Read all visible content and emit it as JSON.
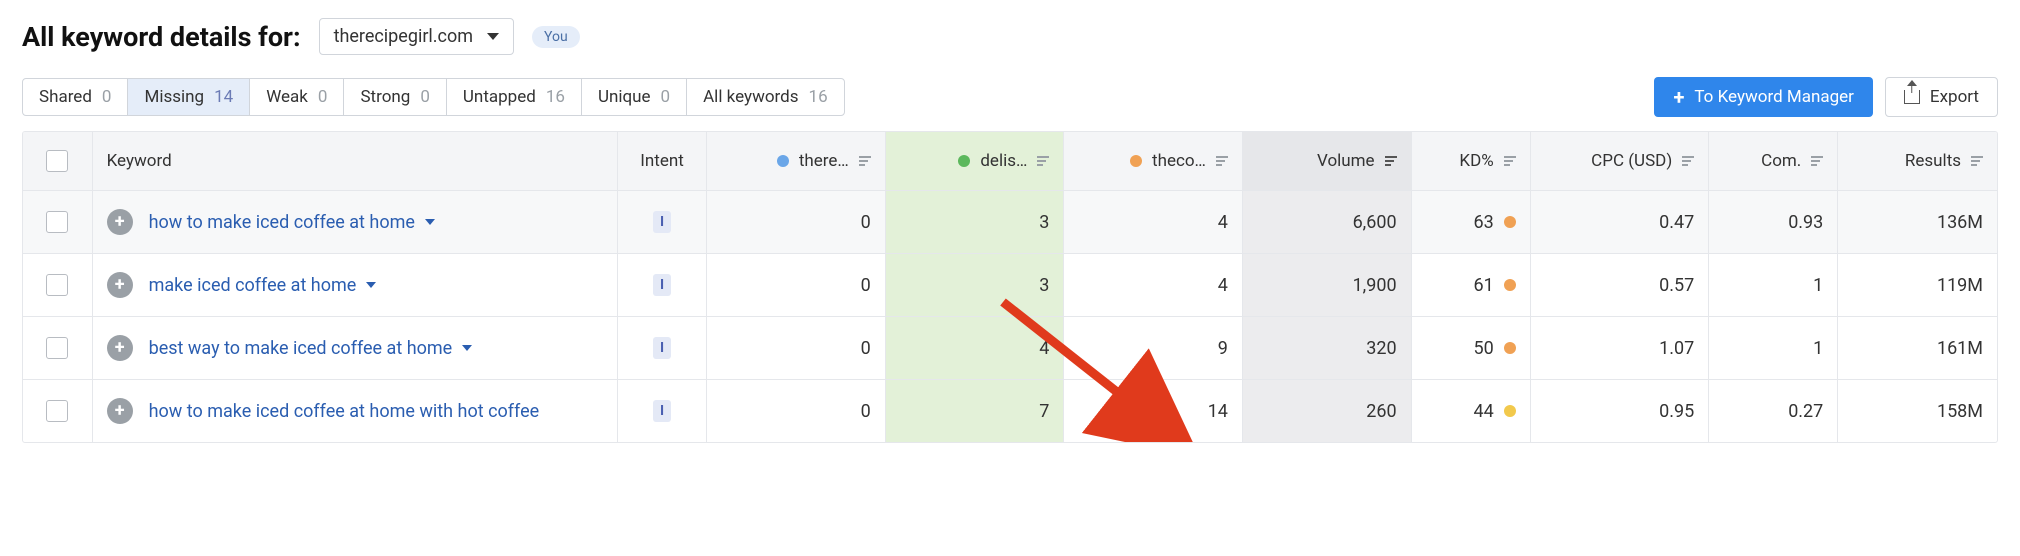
{
  "header": {
    "title": "All keyword details for:",
    "selected_domain": "therecipegirl.com",
    "you_tag": "You"
  },
  "tabs": [
    {
      "label": "Shared",
      "count": "0",
      "active": false
    },
    {
      "label": "Missing",
      "count": "14",
      "active": true
    },
    {
      "label": "Weak",
      "count": "0",
      "active": false
    },
    {
      "label": "Strong",
      "count": "0",
      "active": false
    },
    {
      "label": "Untapped",
      "count": "16",
      "active": false
    },
    {
      "label": "Unique",
      "count": "0",
      "active": false
    },
    {
      "label": "All keywords",
      "count": "16",
      "active": false
    }
  ],
  "actions": {
    "to_manager": "To Keyword Manager",
    "export": "Export"
  },
  "columns": {
    "keyword": "Keyword",
    "intent": "Intent",
    "site1": "there…",
    "site2": "delis…",
    "site3": "theco…",
    "volume": "Volume",
    "kd": "KD%",
    "cpc": "CPC (USD)",
    "com": "Com.",
    "results": "Results"
  },
  "site_colors": {
    "site1": "dot-blue",
    "site2": "dot-green",
    "site3": "dot-orange"
  },
  "rows": [
    {
      "keyword": "how to make iced coffee at home",
      "intent": "I",
      "site1": "0",
      "site2": "3",
      "site3": "4",
      "volume": "6,600",
      "kd": "63",
      "kd_color": "dot-orange",
      "cpc": "0.47",
      "com": "0.93",
      "results": "136M",
      "highlight": true,
      "truncated": false
    },
    {
      "keyword": "make iced coffee at home",
      "intent": "I",
      "site1": "0",
      "site2": "3",
      "site3": "4",
      "volume": "1,900",
      "kd": "61",
      "kd_color": "dot-orange",
      "cpc": "0.57",
      "com": "1",
      "results": "119M",
      "highlight": false,
      "truncated": false
    },
    {
      "keyword": "best way to make iced coffee at home",
      "intent": "I",
      "site1": "0",
      "site2": "4",
      "site3": "9",
      "volume": "320",
      "kd": "50",
      "kd_color": "dot-orange",
      "cpc": "1.07",
      "com": "1",
      "results": "161M",
      "highlight": false,
      "truncated": false
    },
    {
      "keyword": "how to make iced coffee at home with hot coffee",
      "intent": "I",
      "site1": "0",
      "site2": "7",
      "site3": "14",
      "volume": "260",
      "kd": "44",
      "kd_color": "dot-yellow",
      "cpc": "0.95",
      "com": "0.27",
      "results": "158M",
      "highlight": false,
      "truncated": true
    }
  ]
}
